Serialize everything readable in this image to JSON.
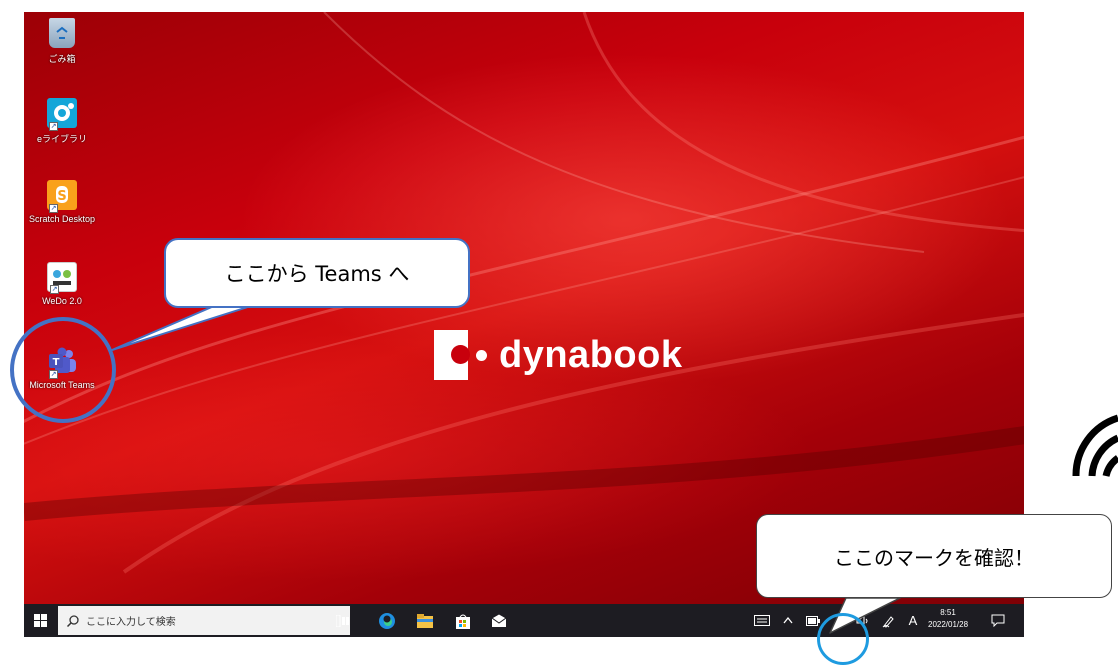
{
  "desktop": {
    "icons": [
      {
        "label": "ごみ箱",
        "icon": "recycle-bin-icon"
      },
      {
        "label": "eライブラリ",
        "icon": "e-library-icon"
      },
      {
        "label": "Scratch Desktop",
        "icon": "scratch-icon"
      },
      {
        "label": "WeDo 2.0",
        "icon": "wedo-icon"
      },
      {
        "label": "Microsoft Teams",
        "icon": "teams-icon"
      }
    ],
    "brand": "dynabook"
  },
  "taskbar": {
    "search_placeholder": "ここに入力して検索",
    "ime_label": "A",
    "time": "8:51",
    "date": "2022/01/28"
  },
  "annotations": {
    "teams_callout": "ここから Teams へ",
    "network_callout": "ここのマークを確認！"
  },
  "colors": {
    "accent_blue": "#4472c4",
    "ring_blue": "#1e9be0",
    "desktop_red": "#c8000c"
  }
}
